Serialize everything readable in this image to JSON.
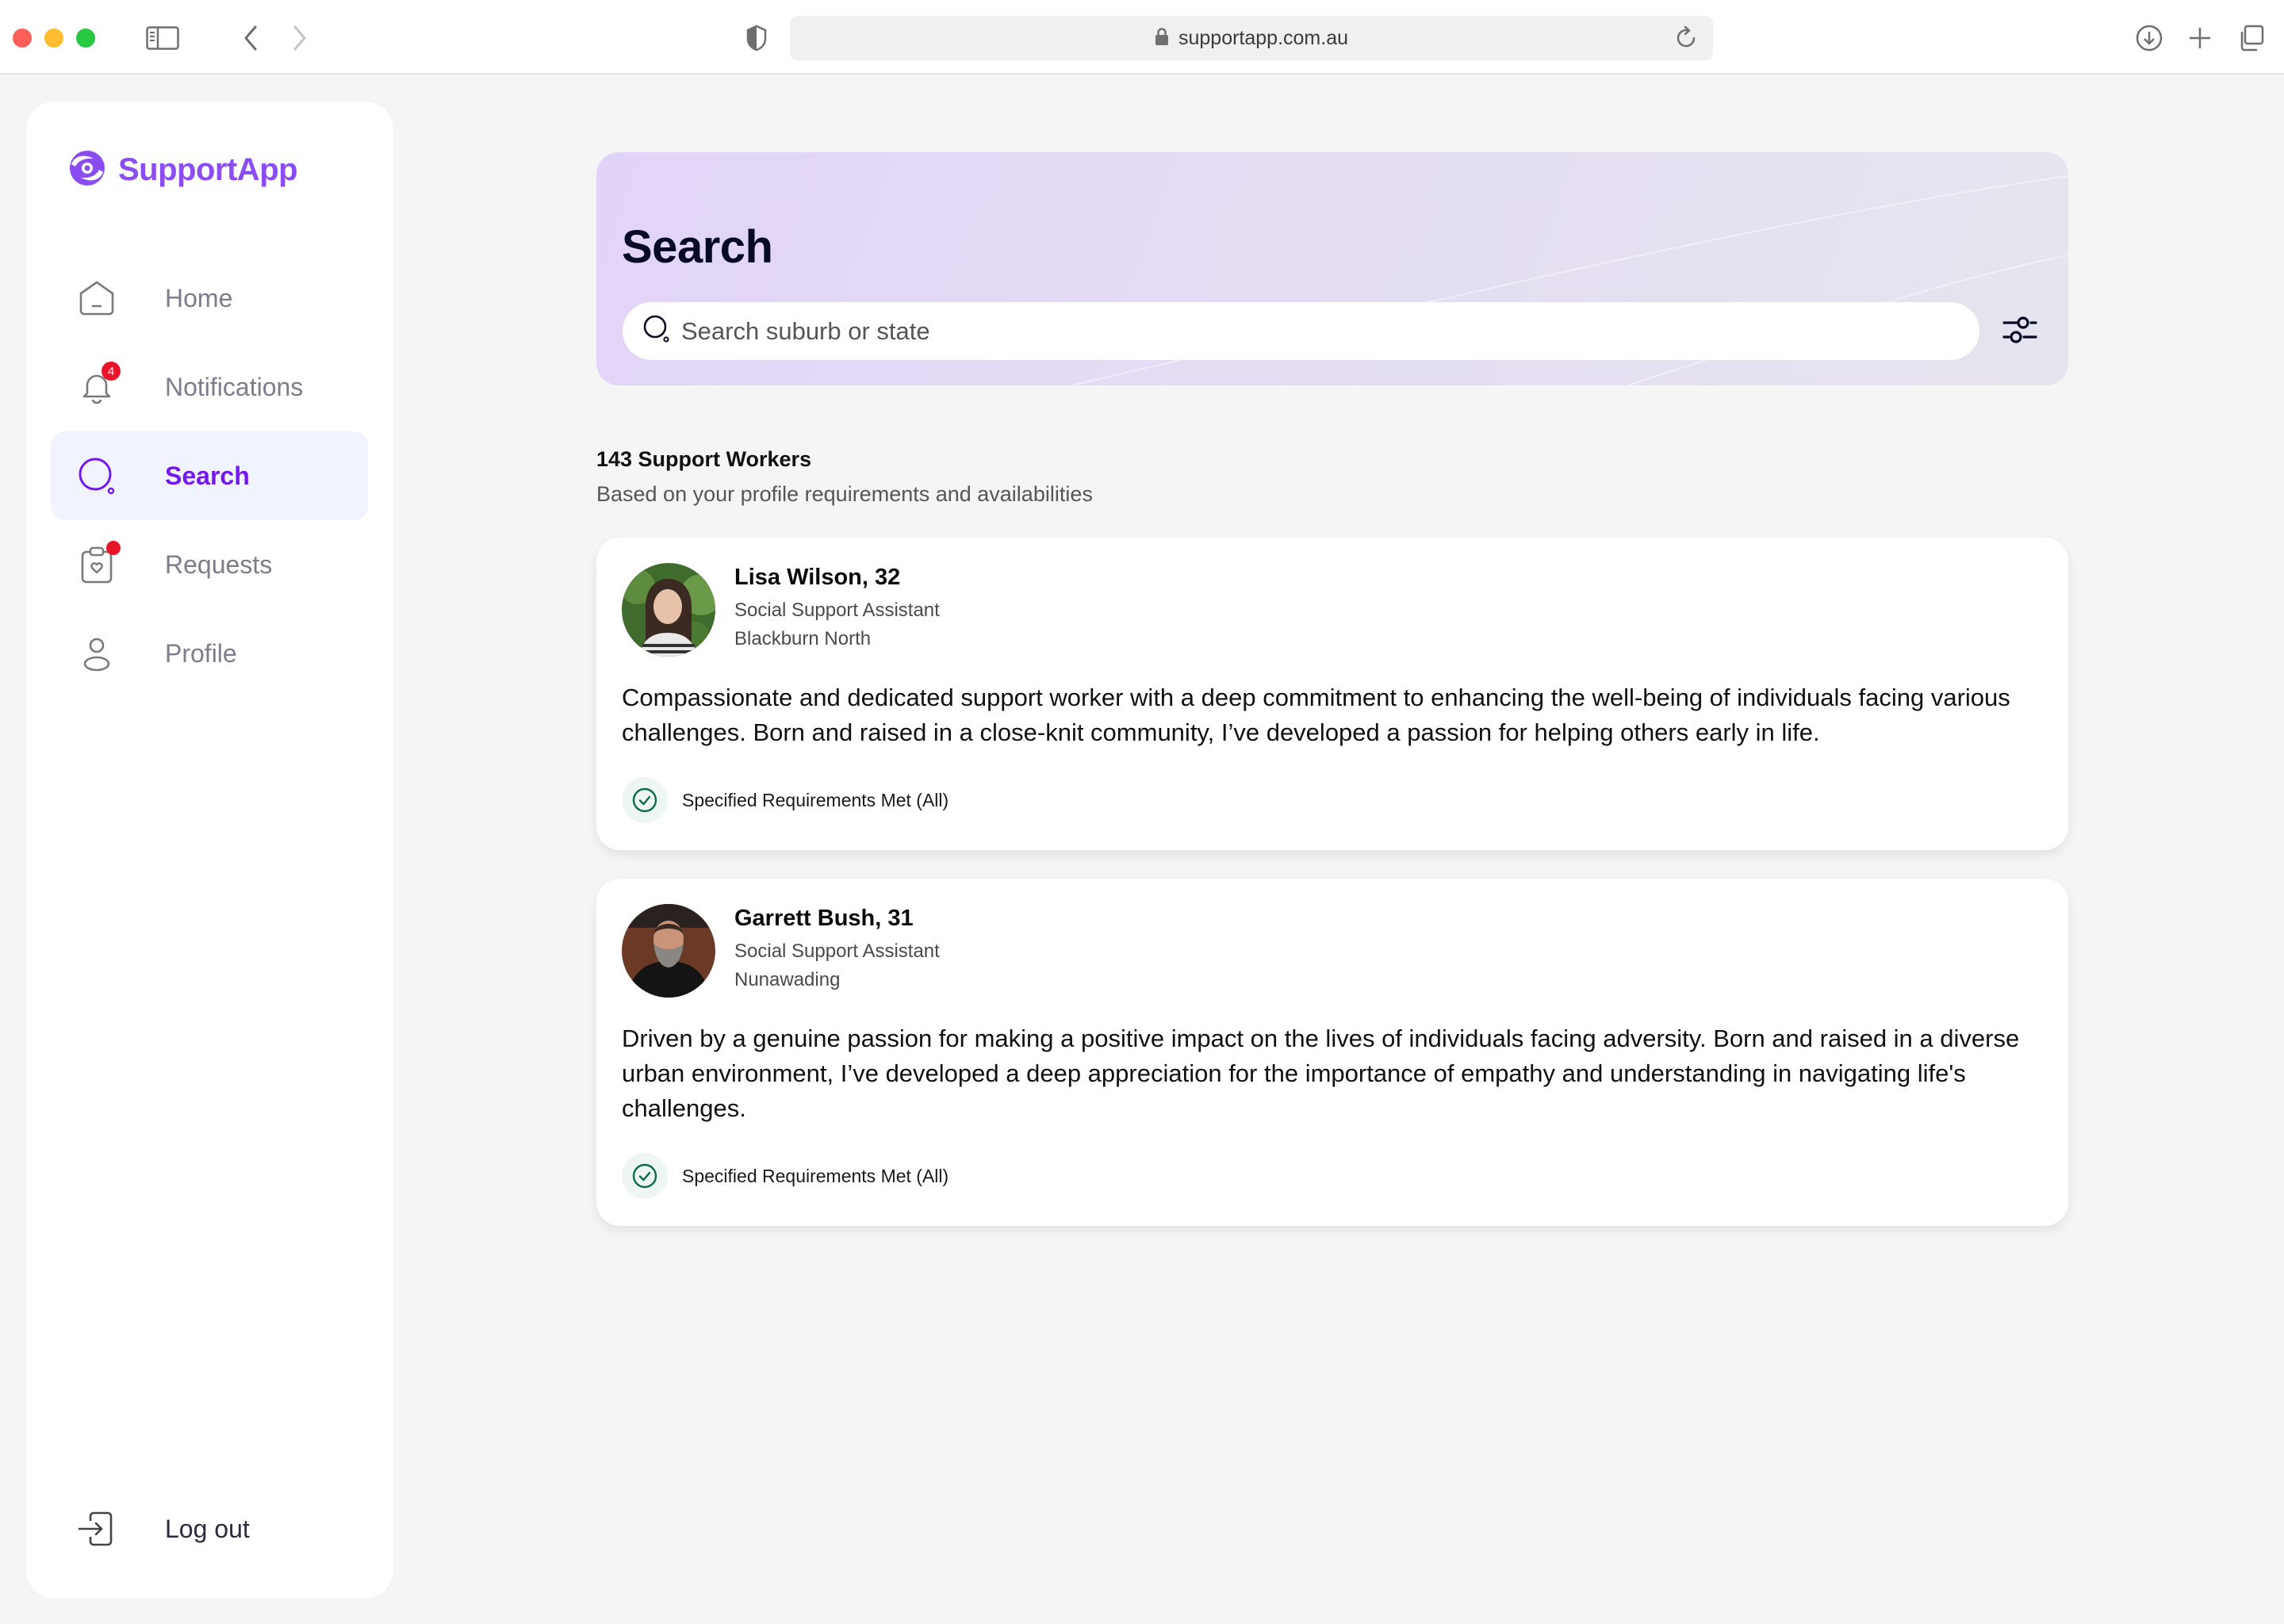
{
  "browser": {
    "url": "supportapp.com.au",
    "icons": [
      "sidebar-toggle-icon",
      "back-icon",
      "forward-icon",
      "shield-icon",
      "lock-icon",
      "reload-icon",
      "download-icon",
      "new-tab-icon",
      "tabs-overview-icon"
    ]
  },
  "app": {
    "name": "SupportApp",
    "brand_color": "#8b4cf2",
    "active_color": "#7319f0",
    "badge_color": "#e8142a"
  },
  "sidebar": {
    "items": [
      {
        "label": "Home",
        "icon": "home-icon",
        "active": false
      },
      {
        "label": "Notifications",
        "icon": "bell-icon",
        "active": false,
        "badge": "4"
      },
      {
        "label": "Search",
        "icon": "search-icon",
        "active": true
      },
      {
        "label": "Requests",
        "icon": "clipboard-heart-icon",
        "active": false,
        "dot": true
      },
      {
        "label": "Profile",
        "icon": "user-icon",
        "active": false
      }
    ],
    "logout_label": "Log out"
  },
  "search": {
    "title": "Search",
    "placeholder": "Search suburb or state",
    "value": ""
  },
  "results": {
    "count_label": "143 Support Workers",
    "subtitle": "Based on your profile requirements and availabilities",
    "workers": [
      {
        "name": "Lisa Wilson, 32",
        "role": "Social Support Assistant",
        "location": "Blackburn North",
        "bio": "Compassionate and dedicated support worker with a deep commitment to enhancing the well-being of individuals facing various challenges. Born and raised in a close-knit community, I’ve developed a passion for helping others early in life.",
        "requirements": "Specified Requirements Met (All)"
      },
      {
        "name": "Garrett Bush, 31",
        "role": "Social Support Assistant",
        "location": "Nunawading",
        "bio": "Driven by a genuine passion for making a positive impact on the lives of individuals facing adversity. Born and raised in a diverse urban environment, I’ve developed a deep appreciation for the importance of empathy and understanding in navigating life's challenges.",
        "requirements": "Specified Requirements Met (All)"
      }
    ]
  }
}
